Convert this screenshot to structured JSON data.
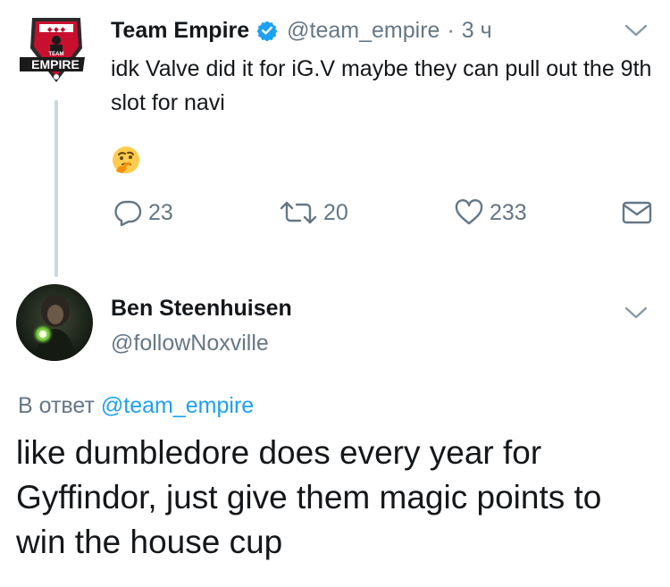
{
  "tweet1": {
    "avatar": {
      "logo_top": "TEAM",
      "logo_main": "EMPIRE",
      "color": "#c8102e"
    },
    "name": "Team Empire",
    "verified": true,
    "handle": "@team_empire",
    "separator": "·",
    "time": "3 ч",
    "text": "idk Valve did it for iG.V maybe they can pull out the 9th slot for navi",
    "emoji": "thinking-face",
    "actions": {
      "replies": "23",
      "retweets": "20",
      "likes": "233"
    }
  },
  "tweet2": {
    "name": "Ben Steenhuisen",
    "handle": "@followNoxville",
    "reply_prefix": "В ответ",
    "reply_to": "@team_empire",
    "text": "like dumbledore does every year for Gyffindor, just give them magic points to win the house cup"
  },
  "colors": {
    "accent": "#1da1f2",
    "secondary_text": "#657786",
    "thread_line": "#ccd6dd"
  }
}
